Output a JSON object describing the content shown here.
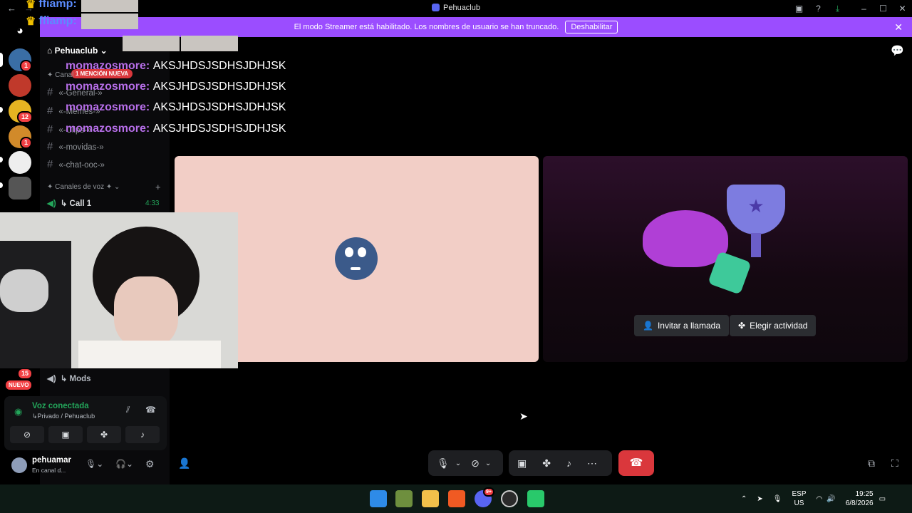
{
  "window": {
    "title": "Pehuaclub"
  },
  "banner": {
    "text": "El modo Streamer está habilitado. Los nombres de usuario se han truncado.",
    "button": "Deshabilitar"
  },
  "server": {
    "name": "Pehuaclub",
    "mention_badge": "1 MENCIÓN NUEVA"
  },
  "servers": [
    {
      "badge": "1"
    },
    {
      "badge": "12"
    },
    {
      "badge": "1"
    },
    {
      "badge": "15"
    },
    {
      "badge": "NUEVO"
    }
  ],
  "channels": {
    "text_section": "Canal",
    "items": [
      "«-General-»",
      "«-Memes-»",
      "«-Clips-»",
      "«-movidas-»",
      "«-chat-ooc-»"
    ],
    "voice_section": "✦ Canales de voz ✦",
    "voice": [
      {
        "name": "↳ Call 1",
        "time": "4:33"
      },
      {
        "name": "↳ Mods"
      }
    ]
  },
  "voice_panel": {
    "status": "Voz conectada",
    "channel": "↳Privado / Pehuaclub"
  },
  "user": {
    "name": "pehuamar",
    "status": "En canal d..."
  },
  "overlay": {
    "top_rows": [
      {
        "name": "ffiamp:"
      },
      {
        "name": "ffiamp:"
      }
    ],
    "chat": [
      {
        "name": "momazosmore:",
        "msg": "AKSJHDSJSDHSJDHJSK"
      },
      {
        "name": "momazosmore:",
        "msg": "AKSJHDSJSDHSJDHJSK"
      },
      {
        "name": "momazosmore:",
        "msg": "AKSJHDSJSDHSJDHJSK"
      },
      {
        "name": "momazosmore:",
        "msg": "AKSJHDSJSDHSJDHJSK"
      }
    ]
  },
  "call": {
    "invite": "Invitar a llamada",
    "activity": "Elegir actividad"
  },
  "taskbar": {
    "lang1": "ESP",
    "lang2": "US",
    "time": "19:25",
    "date": "6/8/2026",
    "discord_badge": "9+"
  },
  "colors": {
    "accent": "#9b4dff",
    "hangup": "#da373c",
    "voice_green": "#23a55a",
    "tile_pink": "#f2cec6"
  }
}
